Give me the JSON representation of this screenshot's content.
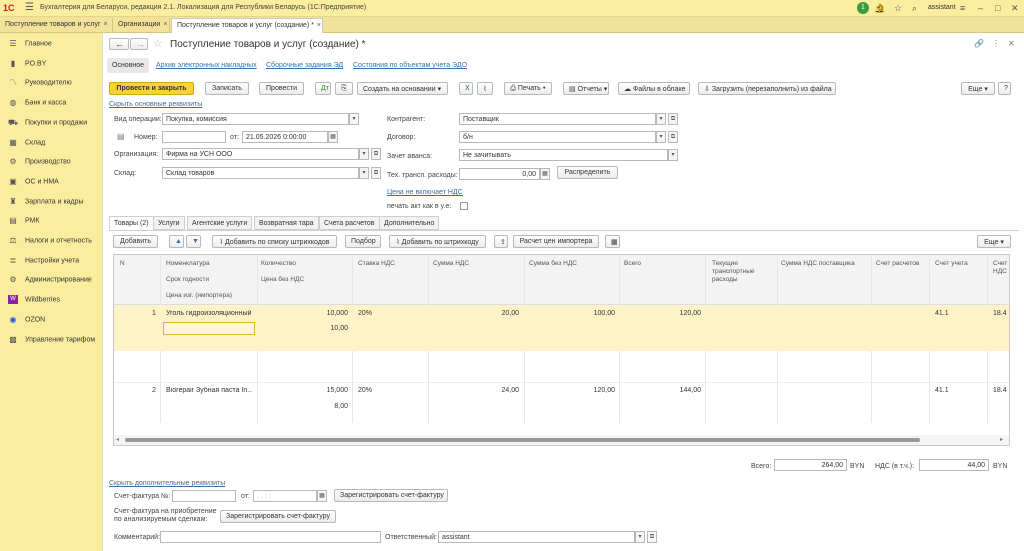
{
  "app": {
    "logo": "1С",
    "title": "Бухгалтерия для Беларуси, редакция 2.1. Локализация для Республики Беларусь   (1С:Предприятие)",
    "user": "assistant",
    "notif_count": "1"
  },
  "window_tabs": [
    {
      "label": "Поступление товаров и услуг"
    },
    {
      "label": "Организации"
    },
    {
      "label": "Поступление товаров и услуг (создание) *"
    }
  ],
  "sidebar": {
    "items": [
      {
        "label": "Главное",
        "icon": "menu-icon"
      },
      {
        "label": "PO.BY",
        "icon": "signal-icon"
      },
      {
        "label": "Руководителю",
        "icon": "chart-icon"
      },
      {
        "label": "Банк и касса",
        "icon": "bank-icon"
      },
      {
        "label": "Покупки и продажи",
        "icon": "cart-icon"
      },
      {
        "label": "Склад",
        "icon": "warehouse-icon"
      },
      {
        "label": "Производство",
        "icon": "factory-icon"
      },
      {
        "label": "ОС и НМА",
        "icon": "assets-icon"
      },
      {
        "label": "Зарплата и кадры",
        "icon": "people-icon"
      },
      {
        "label": "РМК",
        "icon": "register-icon"
      },
      {
        "label": "Налоги и отчетность",
        "icon": "taxes-icon"
      },
      {
        "label": "Настройки учета",
        "icon": "settings-icon"
      },
      {
        "label": "Администрирование",
        "icon": "gear-icon"
      },
      {
        "label": "Wildberries",
        "icon": "wildberries-icon"
      },
      {
        "label": "OZON",
        "icon": "ozon-icon"
      },
      {
        "label": "Управление тарифом",
        "icon": "tariff-icon"
      }
    ]
  },
  "doc": {
    "title": "Поступление товаров и услуг (создание) *"
  },
  "nav_links": {
    "main": "Основное",
    "archive": "Архив электронных накладных",
    "tasks": "Сборочные задания ЭД",
    "states": "Состояния по объектам учета ЭДО"
  },
  "toolbar": {
    "post_close": "Провести и закрыть",
    "save": "Записать",
    "post": "Провести",
    "create_based": "Создать на основании",
    "print": "Печать",
    "reports": "Отчеты",
    "files_cloud": "Файлы в облаке",
    "load_file": "Загрузить (перезаполнить) из файла",
    "more": "Еще"
  },
  "header": {
    "hide_link": "Скрыть основные реквизиты",
    "op_label": "Вид операции:",
    "op_value": "Покупка, комиссия",
    "num_label": "Номер:",
    "num_value": "",
    "date_label": "от:",
    "date_value": "21.05.2026  0:00:00",
    "org_label": "Организация:",
    "org_value": "Фирма на УСН ООО",
    "wh_label": "Склад:",
    "wh_value": "Склад товаров",
    "contr_label": "Контрагент:",
    "contr_value": "Поставщик",
    "contract_label": "Договор:",
    "contract_value": "б/н",
    "advance_label": "Зачет аванса:",
    "advance_value": "Не зачитывать",
    "transp_label": "Тех. трансп. расходы:",
    "transp_value": "0,00",
    "distribute": "Распределить",
    "vat_link": "Цена не включает НДС",
    "print_act_label": "печать акт как в у.е:"
  },
  "tabs": [
    {
      "label": "Товары (2)"
    },
    {
      "label": "Услуги"
    },
    {
      "label": "Агентские услуги"
    },
    {
      "label": "Возвратная тара"
    },
    {
      "label": "Счета расчетов"
    },
    {
      "label": "Дополнительно"
    }
  ],
  "goods_toolbar": {
    "add": "Добавить",
    "add_by_list": "Добавить по списку штрихкодов",
    "pick": "Подбор",
    "add_barcode": "Добавить по штрихкоду",
    "importer_calc": "Расчет цен импортера",
    "more": "Еще"
  },
  "table": {
    "columns": {
      "n": "N",
      "nom": "Номенклатура",
      "shelf": "Срок годности",
      "imp_price": "Цена изг. (импортера)",
      "qty": "Количество",
      "price": "Цена без НДС",
      "vat_rate": "Ставка НДС",
      "vat_sum": "Сумма НДС",
      "sum_no_vat": "Сумма без НДС",
      "total": "Всего",
      "transport": "Текущие транспортные расходы",
      "supp_vat": "Сумма НДС поставщика",
      "acc_settle": "Счет расчетов",
      "acc": "Счет учета",
      "acc_vat": "Счет НДС"
    },
    "rows": [
      {
        "n": "1",
        "nom": "Уголь гидроизоляционный...",
        "qty": "10,000",
        "price": "10,00",
        "vat_rate": "20%",
        "vat_sum": "20,00",
        "sum_no_vat": "100,00",
        "total": "120,00",
        "acc": "41.1",
        "acc_vat": "18.4"
      },
      {
        "n": "2",
        "nom": "Biorepair Зубная паста In...",
        "qty": "15,000",
        "price": "8,00",
        "vat_rate": "20%",
        "vat_sum": "24,00",
        "sum_no_vat": "120,00",
        "total": "144,00",
        "acc": "41.1",
        "acc_vat": "18.4"
      }
    ]
  },
  "totals": {
    "total_label": "Всего:",
    "total_value": "264,00",
    "currency": "BYN",
    "vat_label": "НДС (в т.ч.):",
    "vat_value": "44,00"
  },
  "footer": {
    "hide_extra": "Скрыть дополнительные реквизиты",
    "invoice_label": "Счет-фактура №:",
    "invoice_value": "",
    "invoice_from_label": "от:",
    "invoice_date_ph": ". .  :  :",
    "register_invoice": "Зарегистрировать счет-фактуру",
    "invoice_acq_label": "Счет-фактура на приобретение по анализируемым сделкам:",
    "register_invoice2": "Зарегистрировать счет-фактуру",
    "comment_label": "Комментарий:",
    "comment_value": "",
    "resp_label": "Ответственный:",
    "resp_value": "assistant"
  },
  "colors": {
    "accent": "#f7d23b",
    "sidebar_bg": "#fbed9e",
    "selected_row": "#fdf3c7",
    "link": "#3a6ea5"
  }
}
